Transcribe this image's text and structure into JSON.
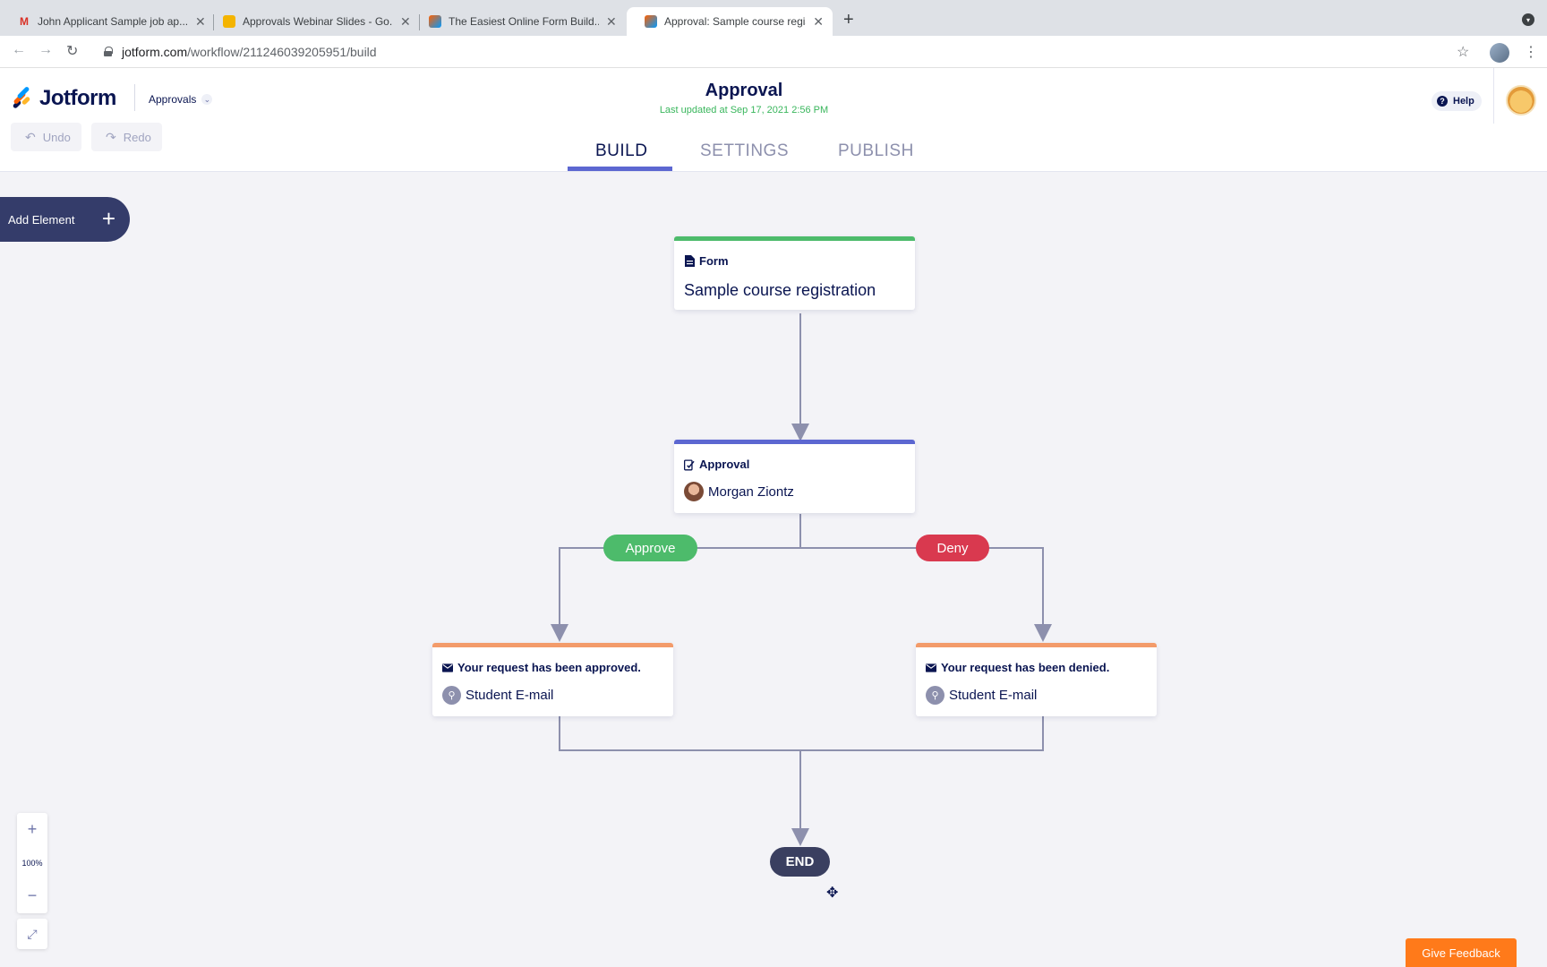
{
  "browser": {
    "tabs": [
      {
        "label": "John Applicant Sample job ap...",
        "favicon": "gmail-icon",
        "color": "#d93025",
        "glyph": "M"
      },
      {
        "label": "Approvals Webinar Slides - Go...",
        "favicon": "slides-icon",
        "color": "#f4b400",
        "glyph": ""
      },
      {
        "label": "The Easiest Online Form Build...",
        "favicon": "jotform-icon",
        "color": "#ff6100",
        "glyph": ""
      },
      {
        "label": "Approval: Sample course regis...",
        "favicon": "jotform-icon",
        "color": "#ff6100",
        "glyph": ""
      }
    ],
    "url_domain": "jotform.com",
    "url_path": "/workflow/211246039205951/build"
  },
  "header": {
    "brand": "Jotform",
    "breadcrumb": "Approvals",
    "title": "Approval",
    "subtitle": "Last updated at Sep 17, 2021 2:56 PM",
    "help_label": "Help",
    "undo_label": "Undo",
    "redo_label": "Redo",
    "tabs": [
      "BUILD",
      "SETTINGS",
      "PUBLISH"
    ],
    "active_tab": "BUILD"
  },
  "canvas": {
    "add_element_label": "Add Element",
    "nodes": {
      "form": {
        "type": "Form",
        "title": "Sample course registration",
        "color": "#4dbb6b"
      },
      "approval": {
        "type": "Approval",
        "assignee": "Morgan Ziontz",
        "color": "#5c67d1"
      },
      "approved_email": {
        "type": "Your request has been approved.",
        "recipient": "Student E-mail",
        "color": "#f39b6a"
      },
      "denied_email": {
        "type": "Your request has been denied.",
        "recipient": "Student E-mail",
        "color": "#f39b6a"
      }
    },
    "branches": {
      "approve": {
        "label": "Approve",
        "color": "#4dbb6b"
      },
      "deny": {
        "label": "Deny",
        "color": "#d9394f"
      }
    },
    "end_label": "END",
    "zoom_level": "100%"
  },
  "feedback_label": "Give Feedback"
}
